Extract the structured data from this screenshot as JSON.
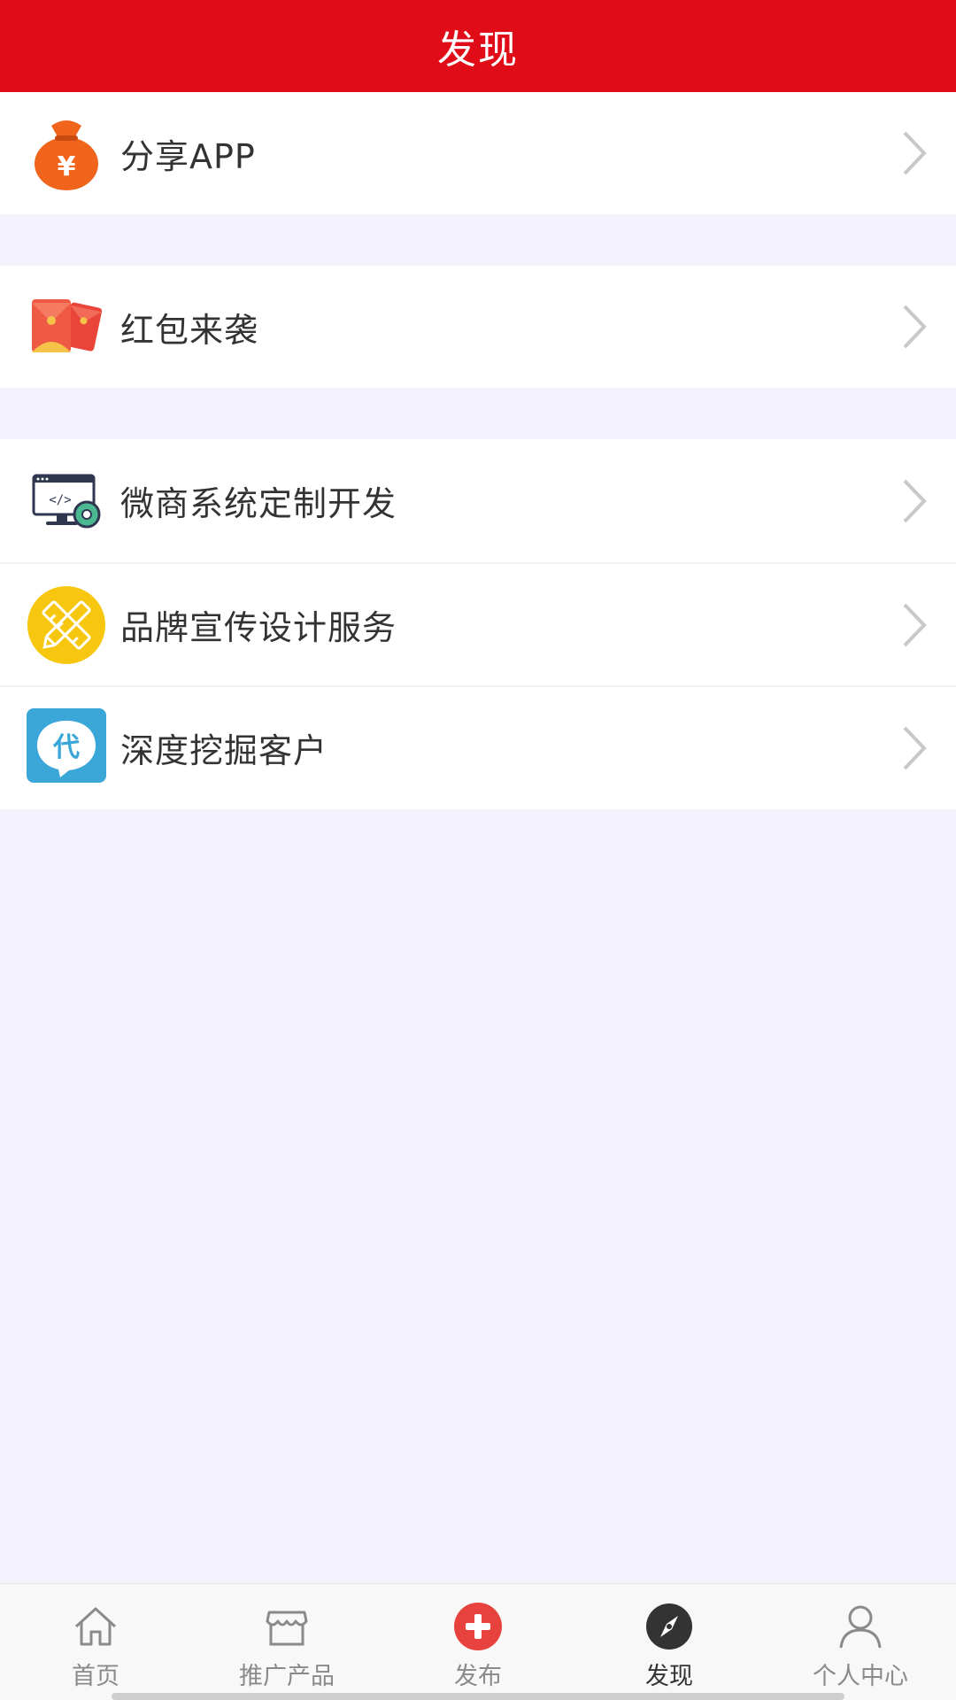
{
  "header": {
    "title": "发现"
  },
  "menu": {
    "share": {
      "label": "分享APP",
      "icon": "money-bag-icon"
    },
    "redpacket": {
      "label": "红包来袭",
      "icon": "red-envelope-icon"
    },
    "services": [
      {
        "label": "微商系统定制开发",
        "icon": "monitor-code-gear-icon"
      },
      {
        "label": "品牌宣传设计服务",
        "icon": "pencil-ruler-icon"
      },
      {
        "label": "深度挖掘客户",
        "icon": "dai-badge-icon"
      }
    ]
  },
  "tabbar": {
    "items": [
      {
        "label": "首页",
        "icon": "home-icon"
      },
      {
        "label": "推广产品",
        "icon": "shop-icon"
      },
      {
        "label": "发布",
        "icon": "plus-circle-icon"
      },
      {
        "label": "发现",
        "icon": "compass-icon",
        "active": true
      },
      {
        "label": "个人中心",
        "icon": "user-icon"
      }
    ]
  },
  "colors": {
    "header_red": "#e00d18",
    "background": "#f3f2fc",
    "publish_red": "#e8423f",
    "dai_blue": "#3aa7d8",
    "pencil_yellow": "#f7c70f"
  }
}
